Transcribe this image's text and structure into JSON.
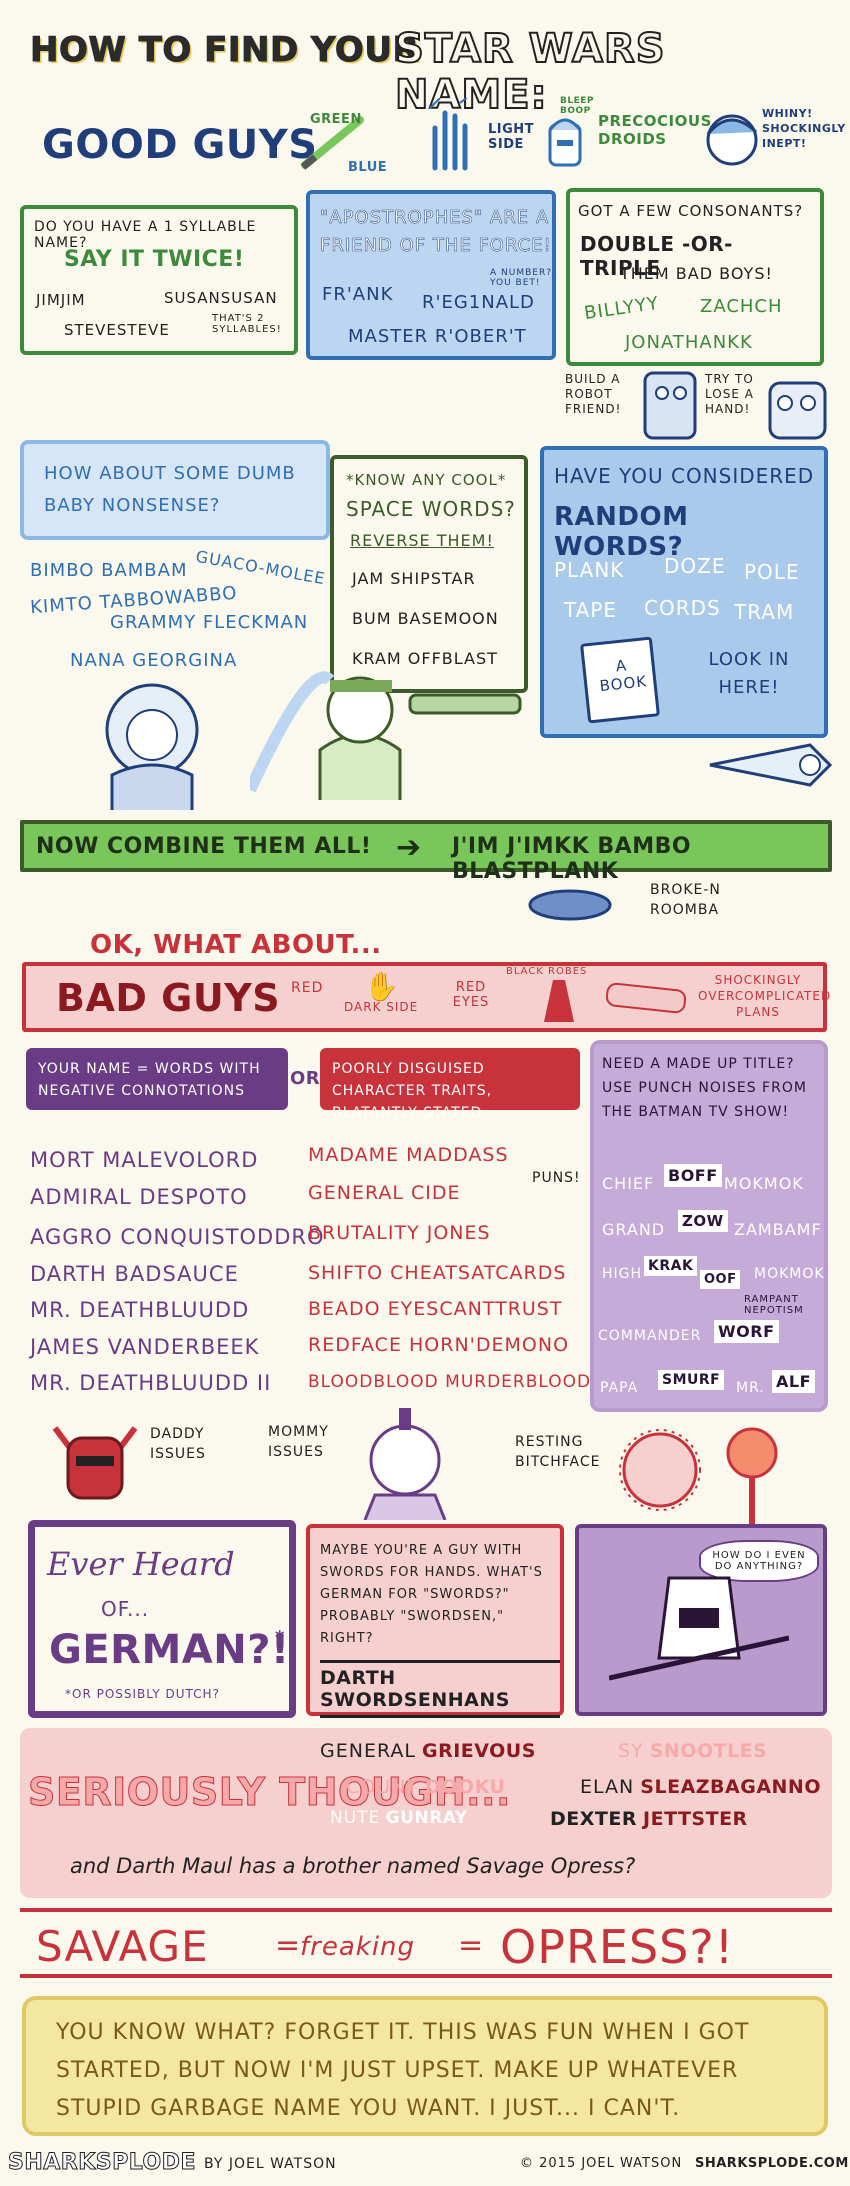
{
  "title": {
    "prefix": "HOW TO FIND YOUR",
    "main": "STAR WARS NAME:"
  },
  "good_guys": {
    "heading": "GOOD GUYS",
    "header_icons": {
      "saber_green": "GREEN",
      "saber_blue": "BLUE",
      "light_side": "LIGHT SIDE",
      "droids": "PRECOCIOUS DROIDS",
      "droid_sound": "BLEEP BOOP",
      "luke": "WHINY! SHOCKINGLY INEPT!"
    },
    "syllable": {
      "q": "DO YOU HAVE A 1 SYLLABLE NAME?",
      "a": "SAY IT TWICE!",
      "ex1": "JIMJIM",
      "ex2": "SUSANSUSAN",
      "ex3": "STEVESTEVE",
      "note": "THAT'S 2 SYLLABLES!"
    },
    "apostrophes": {
      "q": "\"APOSTROPHES\" ARE A FRIEND OF THE FORCE!",
      "ex1": "FR'ANK",
      "ex2": "R'EG1NALD",
      "ex3": "MASTER R'OBER'T",
      "note": "A NUMBER? YOU BET!"
    },
    "consonants": {
      "q": "GOT A FEW CONSONANTS?",
      "a": "DOUBLE -OR- TRIPLE",
      "b": "THEM BAD BOYS!",
      "ex1": "BILLYYY",
      "ex2": "ZACHCH",
      "ex3": "JONATHANKK"
    },
    "robot": {
      "label1": "BUILD A ROBOT FRIEND!",
      "label2": "TRY TO LOSE A HAND!"
    },
    "baby": {
      "q": "HOW ABOUT SOME DUMB BABY NONSENSE?",
      "ex1": "BIMBO BAMBAM",
      "ex2": "GUACO-MOLEE",
      "ex3": "KIMTO TABBOWABBO",
      "ex4": "GRAMMY FLECKMAN",
      "ex5": "NANA GEORGINA"
    },
    "space": {
      "q1": "*KNOW ANY COOL*",
      "q2": "SPACE WORDS?",
      "a": "REVERSE THEM!",
      "ex1": "JAM SHIPSTAR",
      "ex2": "BUM BASEMOON",
      "ex3": "KRAM OFFBLAST"
    },
    "random": {
      "q1": "HAVE YOU CONSIDERED",
      "q2": "RANDOM WORDS?",
      "ex1": "PLANK",
      "ex2": "DOZE",
      "ex3": "POLE",
      "ex4": "TAPE",
      "ex5": "CORDS",
      "ex6": "TRAM",
      "book": "A BOOK",
      "look": "LOOK IN HERE!"
    },
    "combine": {
      "label": "NOW COMBINE THEM ALL!",
      "result": "J'IM J'IMKK BAMBO BLASTPLANK"
    },
    "roomba": "BROKE-N ROOMBA"
  },
  "bad_guys": {
    "intro": "OK, WHAT ABOUT...",
    "heading": "BAD GUYS",
    "header_icons": {
      "red": "RED",
      "dark_side": "DARK SIDE",
      "red_eyes": "RED EYES",
      "robes": "BLACK ROBES",
      "plans": "SHOCKINGLY OVERCOMPLICATED PLANS"
    },
    "negative": {
      "label": "YOUR NAME = WORDS WITH NEGATIVE CONNOTATIONS",
      "or": "OR",
      "items": [
        "MORT MALEVOLORD",
        "ADMIRAL DESPOTO",
        "AGGRO CONQUISTODDRO",
        "DARTH BADSAUCE",
        "MR. DEATHBLUUDD",
        "JAMES VANDERBEEK",
        "MR. DEATHBLUUDD II"
      ]
    },
    "traits": {
      "label": "POORLY DISGUISED CHARACTER TRAITS, BLATANTLY STATED",
      "items": [
        "MADAME MADDASS",
        "GENERAL CIDE",
        "BRUTALITY JONES",
        "SHIFTO CHEATSATCARDS",
        "BEADO EYESCANTTRUST",
        "REDFACE HORN'DEMONO",
        "BLOODBLOOD MURDERBLOOD"
      ],
      "puns": "PUNS!"
    },
    "title": {
      "q": "NEED A MADE UP TITLE? USE PUNCH NOISES FROM THE BATMAN TV SHOW!",
      "r1": [
        "CHIEF",
        "BOFF",
        "MOKMOK"
      ],
      "r2": [
        "GRAND",
        "ZOW",
        "ZAMBAMF"
      ],
      "r3": [
        "HIGH",
        "KRAK",
        "OOF",
        "MOKMOK"
      ],
      "nepotism": "RAMPANT NEPOTISM",
      "r4": [
        "COMMANDER",
        "WORF"
      ],
      "r5": [
        "PAPA",
        "SMURF",
        "MR.",
        "ALF"
      ]
    },
    "issues": {
      "daddy": "DADDY ISSUES",
      "mommy": "MOMMY ISSUES",
      "resting": "RESTING BITCHFACE"
    },
    "german": {
      "l1": "Ever Heard",
      "l2": "OF...",
      "l3": "GERMAN?!",
      "star": "*",
      "note": "*OR POSSIBLY DUTCH?"
    },
    "swords": {
      "text": "MAYBE YOU'RE A GUY WITH SWORDS FOR HANDS. WHAT'S GERMAN FOR \"SWORDS?\" PROBABLY \"SWORDSEN,\" RIGHT?",
      "name": "DARTH SWORDSENHANS"
    },
    "grievous_q": "HOW DO I EVEN DO ANYTHING?"
  },
  "seriously": {
    "label": "SERIOUSLY THOUGH...",
    "names": [
      {
        "first": "GENERAL",
        "last": "GRIEVOUS"
      },
      {
        "first": "SY",
        "last": "SNOOTLES"
      },
      {
        "first": "COUNT",
        "last": "DOOKU"
      },
      {
        "first": "ELAN",
        "last": "SLEAZBAGANNO"
      },
      {
        "first": "NUTE",
        "last": "GUNRAY"
      },
      {
        "first": "DEXTER",
        "last": "JETTSTER"
      }
    ],
    "maul": "and Darth Maul has a brother named Savage Opress?"
  },
  "equation": {
    "left": "SAVAGE",
    "mid": "freaking",
    "right": "OPRESS?!"
  },
  "conclusion": "YOU KNOW WHAT? FORGET IT. THIS WAS FUN WHEN I GOT STARTED, BUT NOW I'M JUST UPSET. MAKE UP WHATEVER STUPID GARBAGE NAME YOU WANT. I JUST... I CAN'T.",
  "footer": {
    "brand": "SHARKSPLODE",
    "by": "BY JOEL WATSON",
    "copy": "© 2015 JOEL WATSON",
    "url": "SHARKSPLODE.COM"
  },
  "colors": {
    "green": "#3d8a3a",
    "blue": "#2f6fb5",
    "red": "#c8323a",
    "purple": "#6b3c86",
    "cream": "#f3e7a2",
    "pink": "#f6d0cf",
    "lavender": "#b89bcc"
  }
}
